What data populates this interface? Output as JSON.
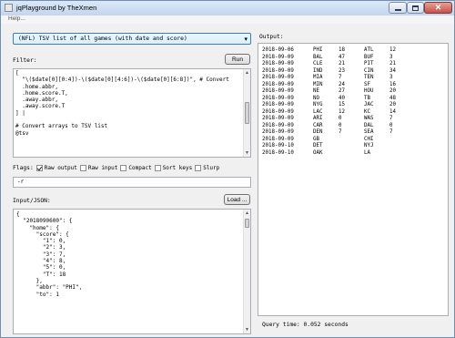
{
  "window": {
    "title": "jqPlayground by TheXmen"
  },
  "menu": {
    "help": "Help..."
  },
  "preset": {
    "selected": "(NFL) TSV list of all games (with date and score)"
  },
  "filter": {
    "label": "Filter:",
    "run_button": "Run",
    "code": "[\n  \"\\($date[0][0:4])-\\($date[0][4:6])-\\($date[0][6:8])\", # Convert\n  .home.abbr,\n  .home.score.T,\n  .away.abbr,\n  .away.score.T\n] |\n\n# Convert arrays to TSV list\n@tsv"
  },
  "flags": {
    "label": "Flags:",
    "items": [
      {
        "label": "Raw output",
        "checked": true
      },
      {
        "label": "Raw input",
        "checked": false
      },
      {
        "label": "Compact",
        "checked": false
      },
      {
        "label": "Sort keys",
        "checked": false
      },
      {
        "label": "Slurp",
        "checked": false
      }
    ],
    "args_value": "-r"
  },
  "input": {
    "label": "Input/JSON:",
    "load_button": "Load ...",
    "json": "{\n  \"2018090600\": {\n    \"home\": {\n      \"score\": {\n        \"1\": 0,\n        \"2\": 3,\n        \"3\": 7,\n        \"4\": 8,\n        \"5\": 0,\n        \"T\": 18\n      },\n      \"abbr\": \"PHI\",\n      \"to\": 1"
  },
  "output": {
    "label": "Output:",
    "rows": [
      [
        "2018-09-06",
        "PHI",
        "18",
        "ATL",
        "12"
      ],
      [
        "2018-09-09",
        "BAL",
        "47",
        "BUF",
        "3"
      ],
      [
        "2018-09-09",
        "CLE",
        "21",
        "PIT",
        "21"
      ],
      [
        "2018-09-09",
        "IND",
        "23",
        "CIN",
        "34"
      ],
      [
        "2018-09-09",
        "MIA",
        "7",
        "TEN",
        "3"
      ],
      [
        "2018-09-09",
        "MIN",
        "24",
        "SF",
        "16"
      ],
      [
        "2018-09-09",
        "NE",
        "27",
        "HOU",
        "20"
      ],
      [
        "2018-09-09",
        "NO",
        "40",
        "TB",
        "48"
      ],
      [
        "2018-09-09",
        "NYG",
        "15",
        "JAC",
        "20"
      ],
      [
        "2018-09-09",
        "LAC",
        "12",
        "KC",
        "14"
      ],
      [
        "2018-09-09",
        "ARI",
        "0",
        "WAS",
        "7"
      ],
      [
        "2018-09-09",
        "CAR",
        "0",
        "DAL",
        "0"
      ],
      [
        "2018-09-09",
        "DEN",
        "7",
        "SEA",
        "7"
      ],
      [
        "2018-09-09",
        "GB",
        "",
        "CHI",
        ""
      ],
      [
        "2018-09-10",
        "DET",
        "",
        "NYJ",
        ""
      ],
      [
        "2018-09-10",
        "OAK",
        "",
        "LA",
        ""
      ]
    ],
    "query_time": "Query time: 0.052 seconds"
  }
}
